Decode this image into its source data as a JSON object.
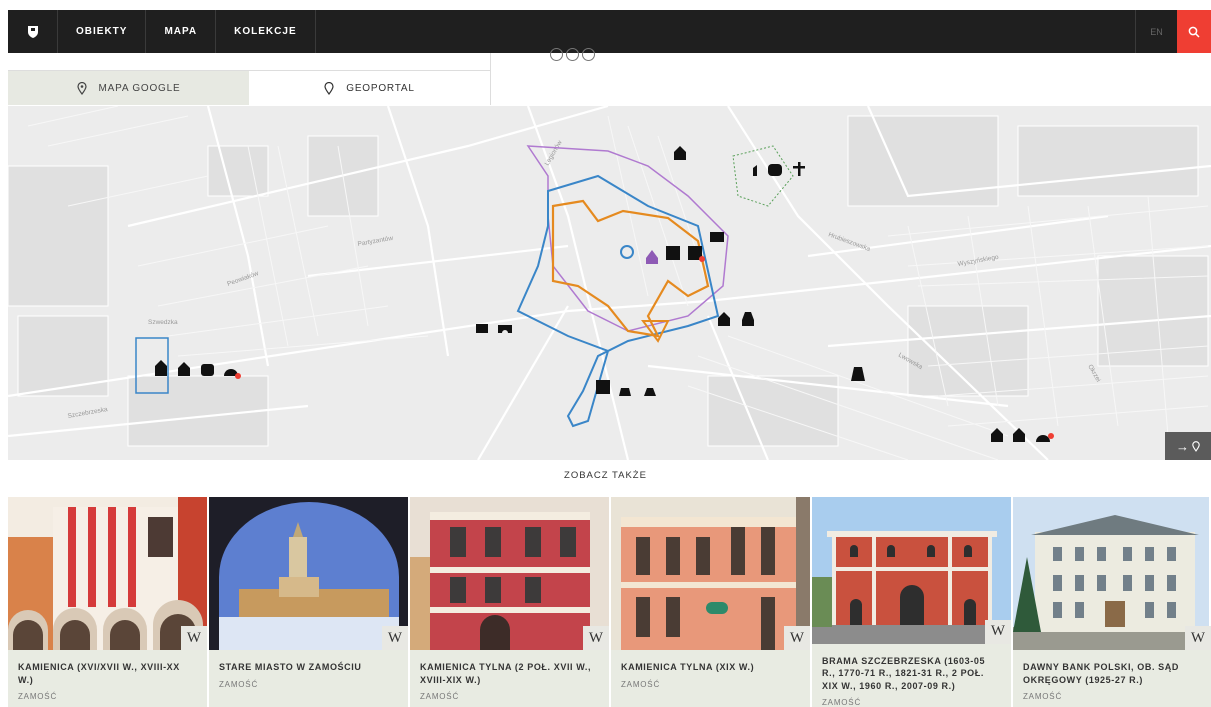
{
  "nav": {
    "items": [
      "OBIEKTY",
      "MAPA",
      "KOLEKCJE"
    ],
    "lang": "EN"
  },
  "tabs": [
    {
      "label": "MAPA GOOGLE",
      "icon": "map-pin-icon",
      "active": true
    },
    {
      "label": "GEOPORTAL",
      "icon": "map-pin-icon",
      "active": false
    }
  ],
  "map": {
    "street_labels": [
      "Szczebrzeska",
      "Szwedzka",
      "Peowiaków",
      "Hrubieszowska",
      "Partyzantów",
      "Lwowska",
      "Wyszyńskiego",
      "Legionów",
      "Okrzei"
    ],
    "expand_label": "→"
  },
  "see_also": {
    "heading": "ZOBACZ TAKŻE",
    "cards": [
      {
        "title": "KAMIENICA (XVI/XVII W., XVIII-XX W.)",
        "city": "ZAMOŚĆ",
        "badge": "W"
      },
      {
        "title": "STARE MIASTO W ZAMOŚCIU",
        "city": "ZAMOŚĆ",
        "badge": "W"
      },
      {
        "title": "KAMIENICA TYLNA (2 POŁ. XVII W., XVIII-XIX W.)",
        "city": "ZAMOŚĆ",
        "badge": "W"
      },
      {
        "title": "KAMIENICA TYLNA (XIX W.)",
        "city": "ZAMOŚĆ",
        "badge": "W"
      },
      {
        "title": "BRAMA SZCZEBRZESKA (1603-05 R., 1770-71 R., 1821-31 R., 2 POŁ. XIX W., 1960 R., 2007-09 R.)",
        "city": "ZAMOŚĆ",
        "badge": "W"
      },
      {
        "title": "DAWNY BANK POLSKI, OB. SĄD OKRĘGOWY (1925-27 R.)",
        "city": "ZAMOŚĆ",
        "badge": "W"
      }
    ]
  },
  "colors": {
    "accent": "#ef3e33",
    "nav_bg": "#1f1f1f",
    "card_bg": "#e8ebe2",
    "route_orange": "#e58a1f",
    "route_blue": "#3a86c8",
    "route_purple": "#b07ad0"
  }
}
